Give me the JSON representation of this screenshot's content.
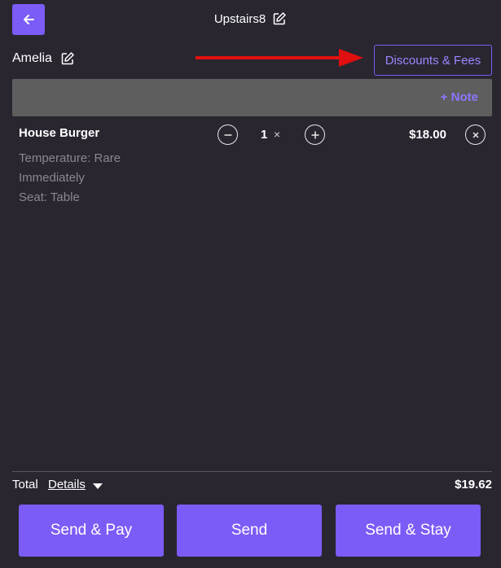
{
  "header": {
    "title": "Upstairs8"
  },
  "customer": {
    "name": "Amelia"
  },
  "discounts_label": "Discounts & Fees",
  "note_label": "+ Note",
  "order_item": {
    "name": "House Burger",
    "modifiers": [
      "Temperature: Rare",
      "Immediately",
      "Seat: Table"
    ],
    "quantity": "1",
    "times_symbol": "×",
    "price": "$18.00"
  },
  "totals": {
    "label": "Total",
    "details_label": "Details",
    "value": "$19.62"
  },
  "actions": {
    "send_pay": "Send & Pay",
    "send": "Send",
    "send_stay": "Send & Stay"
  },
  "colors": {
    "background": "#2a2630",
    "accent": "#7c5cf6",
    "note_bar": "#5e5e5e",
    "annotation_arrow": "#e01010"
  }
}
